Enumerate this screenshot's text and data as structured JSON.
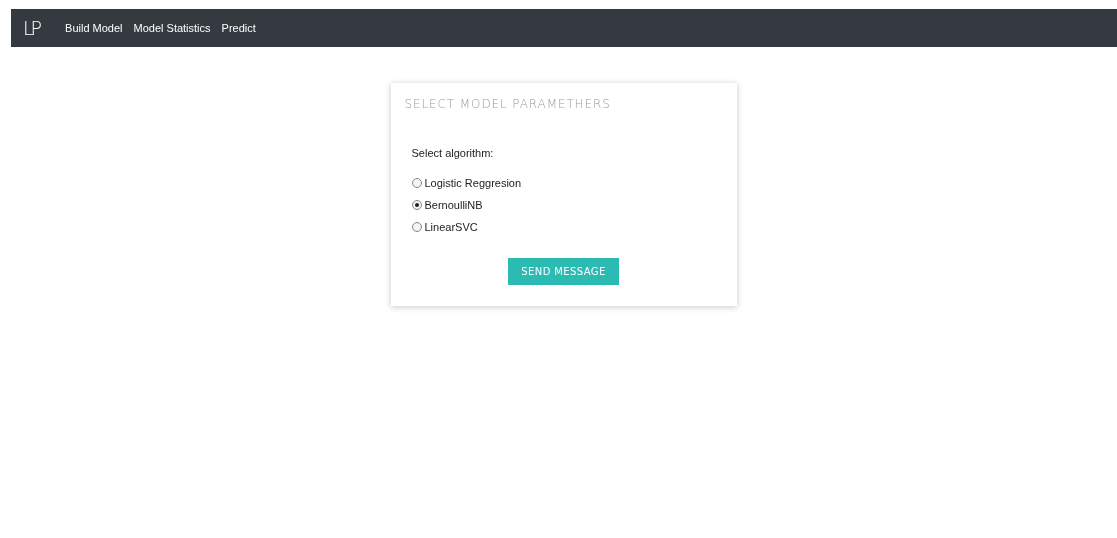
{
  "navbar": {
    "brand": "LP",
    "links": [
      "Build Model",
      "Model Statistics",
      "Predict"
    ]
  },
  "card": {
    "title": "SELECT MODEL PARAMETHERS",
    "label": "Select algorithm:",
    "options": [
      {
        "label": "Logistic Reggresion",
        "selected": false
      },
      {
        "label": "BernoulliNB",
        "selected": true
      },
      {
        "label": "LinearSVC",
        "selected": false
      }
    ],
    "button": "SEND MESSAGE"
  }
}
